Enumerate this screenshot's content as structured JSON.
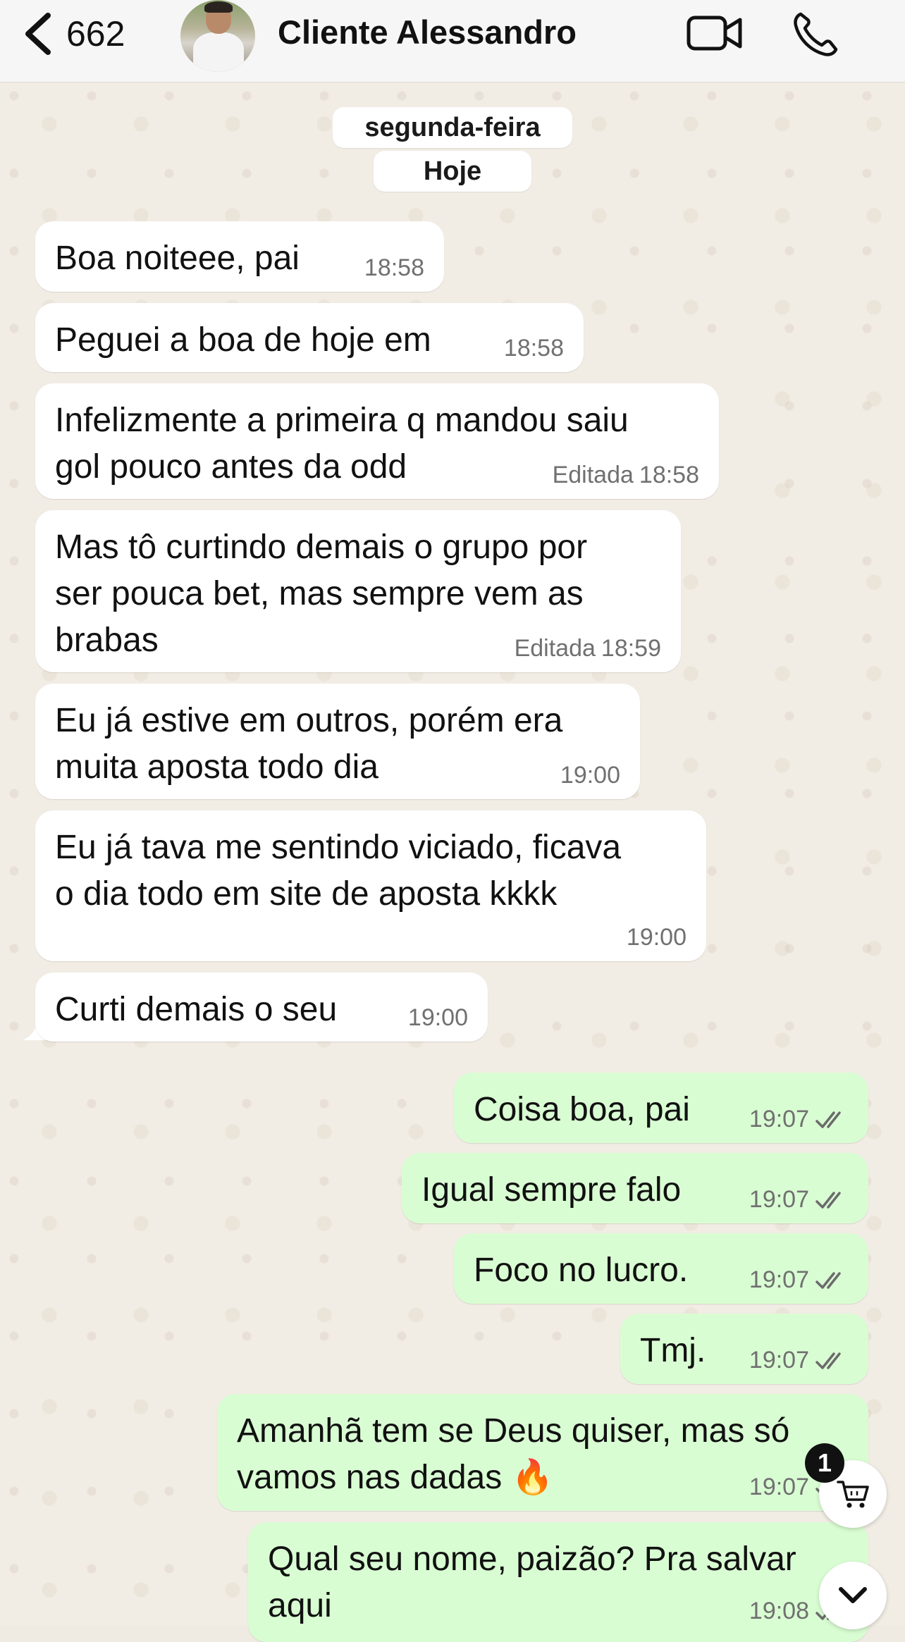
{
  "header": {
    "back_count": "662",
    "contact_name": "Cliente Alessandro"
  },
  "date_pills": {
    "weekday": "segunda-feira",
    "today": "Hoje"
  },
  "messages": [
    {
      "dir": "in",
      "text": "Boa noiteee, pai",
      "time": "18:58"
    },
    {
      "dir": "in",
      "text": "Peguei a boa de hoje em",
      "time": "18:58"
    },
    {
      "dir": "in",
      "text": "Infelizmente a primeira q mandou saiu\ngol pouco antes da odd",
      "edited": "Editada",
      "time": "18:58"
    },
    {
      "dir": "in",
      "text": "Mas tô curtindo demais o grupo por\nser pouca bet, mas sempre vem as\nbrabas",
      "edited": "Editada",
      "time": "18:59"
    },
    {
      "dir": "in",
      "text": "Eu já estive em outros, porém era\nmuita aposta todo dia",
      "time": "19:00"
    },
    {
      "dir": "in",
      "text": "Eu já tava me sentindo viciado, ficava\no dia todo em site de aposta kkkk",
      "time": "19:00"
    },
    {
      "dir": "in",
      "text": "Curti demais o seu",
      "time": "19:00"
    },
    {
      "dir": "out",
      "text": "Coisa boa, pai",
      "time": "19:07"
    },
    {
      "dir": "out",
      "text": "Igual sempre falo",
      "time": "19:07"
    },
    {
      "dir": "out",
      "text": "Foco no lucro.",
      "time": "19:07"
    },
    {
      "dir": "out",
      "text": "Tmj.",
      "time": "19:07"
    },
    {
      "dir": "out",
      "text": "Amanhã tem se Deus quiser, mas só\nvamos nas dadas 🔥",
      "time": "19:07"
    },
    {
      "dir": "out",
      "text": "Qual seu nome, paizão? Pra salvar\naqui",
      "time": "19:08"
    }
  ],
  "cart_badge": "1",
  "icons": {
    "back": "chevron-left-icon",
    "video": "video-camera-icon",
    "phone": "phone-icon",
    "cart": "shopping-cart-icon",
    "scroll_down": "chevron-down-icon",
    "read": "double-check-icon"
  }
}
